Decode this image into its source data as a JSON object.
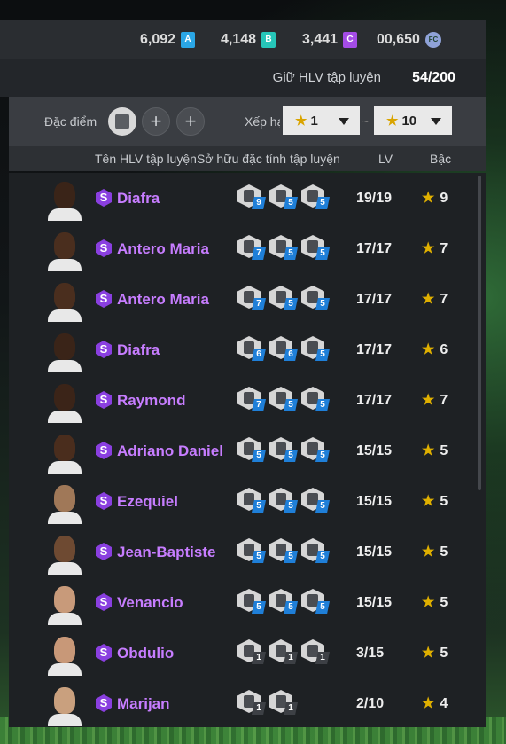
{
  "currencies": [
    {
      "value": "6,092",
      "icon": "A",
      "color": "#2aa6e6"
    },
    {
      "value": "4,148",
      "icon": "B",
      "color": "#26c6b9"
    },
    {
      "value": "3,441",
      "icon": "C",
      "color": "#a44ce6"
    },
    {
      "value": "00,650",
      "icon": "FC"
    }
  ],
  "header": {
    "keep_label": "Giữ HLV tập luyện",
    "keep_value": "54/200"
  },
  "filter": {
    "traits_label": "Đặc điểm c",
    "add_symbol": "+",
    "rank_label": "Xếp hạ",
    "rank_from": "1",
    "rank_to": "10",
    "tilde": "~",
    "star": "★"
  },
  "columns": {
    "name": "Tên HLV tập luyện",
    "traits": "Sở hữu đặc tính tập luyện",
    "lv": "LV",
    "grade": "Bậc"
  },
  "rows": [
    {
      "name": "Diafra",
      "badge": "S",
      "traits": [
        "9",
        "5",
        "5"
      ],
      "lv": "19/19",
      "grade": "9",
      "skin": "#3a2418"
    },
    {
      "name": "Antero Maria",
      "badge": "S",
      "traits": [
        "7",
        "5",
        "5"
      ],
      "lv": "17/17",
      "grade": "7",
      "skin": "#4a2e1e"
    },
    {
      "name": "Antero Maria",
      "badge": "S",
      "traits": [
        "7",
        "5",
        "5"
      ],
      "lv": "17/17",
      "grade": "7",
      "skin": "#4a2e1e"
    },
    {
      "name": "Diafra",
      "badge": "S",
      "traits": [
        "6",
        "6",
        "5"
      ],
      "lv": "17/17",
      "grade": "6",
      "skin": "#3a2418"
    },
    {
      "name": "Raymond",
      "badge": "S",
      "traits": [
        "7",
        "5",
        "5"
      ],
      "lv": "17/17",
      "grade": "7",
      "skin": "#3b2418"
    },
    {
      "name": "Adriano Daniel",
      "badge": "S",
      "traits": [
        "5",
        "5",
        "5"
      ],
      "lv": "15/15",
      "grade": "5",
      "skin": "#4a2d1d"
    },
    {
      "name": "Ezequiel",
      "badge": "S",
      "traits": [
        "5",
        "5",
        "5"
      ],
      "lv": "15/15",
      "grade": "5",
      "skin": "#a07858"
    },
    {
      "name": "Jean-Baptiste",
      "badge": "S",
      "traits": [
        "5",
        "5",
        "5"
      ],
      "lv": "15/15",
      "grade": "5",
      "skin": "#6e4a32"
    },
    {
      "name": "Venancio",
      "badge": "S",
      "traits": [
        "5",
        "5",
        "5"
      ],
      "lv": "15/15",
      "grade": "5",
      "skin": "#c89a7a"
    },
    {
      "name": "Obdulio",
      "badge": "S",
      "traits": [
        "1",
        "1",
        "1"
      ],
      "lv": "3/15",
      "grade": "5",
      "skin": "#c89878"
    },
    {
      "name": "Marijan",
      "badge": "S",
      "traits": [
        "1",
        "1"
      ],
      "lv": "2/10",
      "grade": "4",
      "skin": "#c9a07e"
    }
  ]
}
